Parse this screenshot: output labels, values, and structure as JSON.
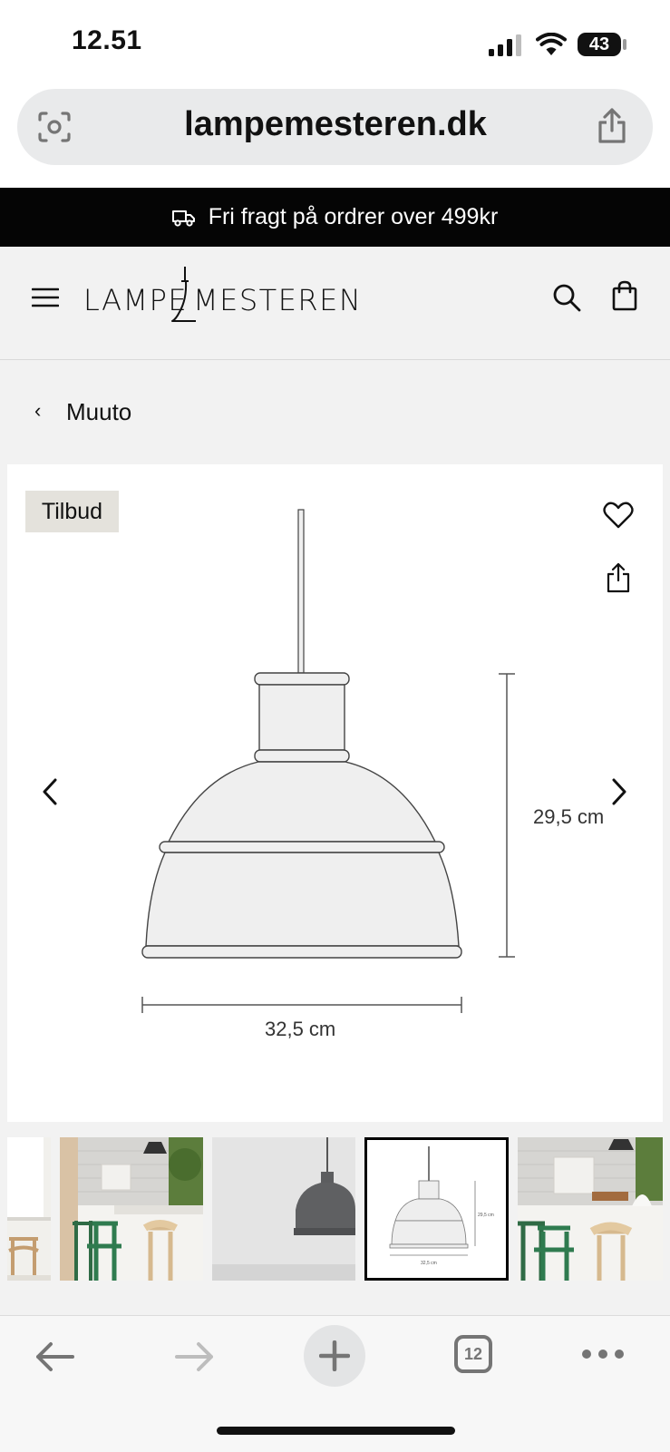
{
  "status_bar": {
    "time": "12.51",
    "battery": "43"
  },
  "browser": {
    "url": "lampemesteren.dk",
    "tabs_count": "12"
  },
  "promo": {
    "icon": "truck-icon",
    "text": "Fri fragt på ordrer over 499kr"
  },
  "header": {
    "logo_left": "LAMPE",
    "logo_right": "MESTEREN"
  },
  "breadcrumb": {
    "label": "Muuto"
  },
  "product": {
    "badge": "Tilbud",
    "dimension_height": "29,5 cm",
    "dimension_width": "32,5 cm"
  },
  "thumbnails": [
    {
      "name": "thumbnail-1",
      "selected": false
    },
    {
      "name": "thumbnail-2",
      "selected": false
    },
    {
      "name": "thumbnail-3",
      "selected": false
    },
    {
      "name": "thumbnail-4",
      "selected": true,
      "height_label": "29,5 cm",
      "width_label": "32,5 cm"
    },
    {
      "name": "thumbnail-5",
      "selected": false
    }
  ],
  "colors": {
    "promo_bg": "#050505",
    "page_bg": "#f2f2f2",
    "badge_bg": "#e4e2dc",
    "icon_gray": "#757575"
  }
}
